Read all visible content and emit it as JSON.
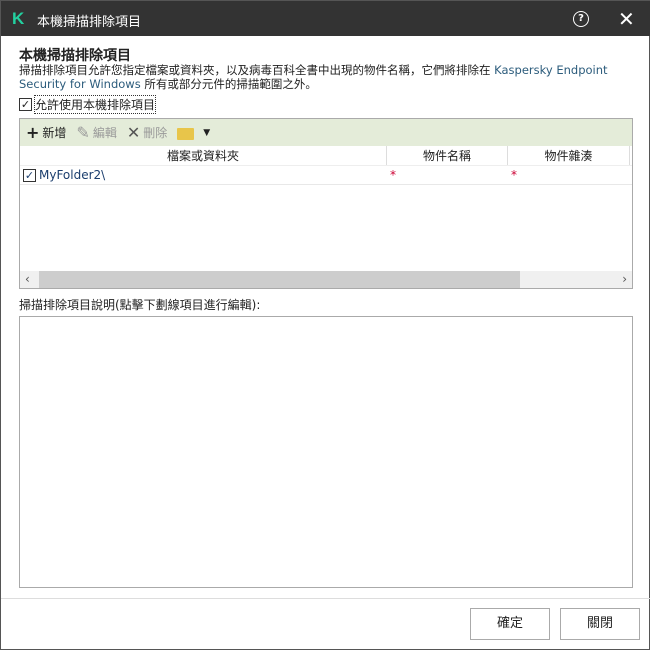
{
  "window": {
    "title": "本機掃描排除項目",
    "logo": "K"
  },
  "heading": "本機掃描排除項目",
  "description": {
    "part1": "掃描排除項目允許您指定檔案或資料夾，以及病毒百科全書中出現的物件名稱，它們將排除在 ",
    "brand": "Kaspersky Endpoint Security for Windows",
    "part2": " 所有或部分元件的掃描範圍之外。"
  },
  "allow_checkbox": {
    "label": "允許使用本機排除項目",
    "checked": true
  },
  "toolbar": {
    "add": "新增",
    "edit": "編輯",
    "delete": "刪除"
  },
  "table": {
    "columns": [
      "檔案或資料夾",
      "物件名稱",
      "物件雜湊"
    ],
    "rows": [
      {
        "path": "MyFolder2\\",
        "object_name": "*",
        "object_hash": "*",
        "checked": true
      }
    ]
  },
  "desc_label": "掃描排除項目說明(點擊下劃線項目進行編輯):",
  "buttons": {
    "ok": "確定",
    "close": "關閉"
  }
}
